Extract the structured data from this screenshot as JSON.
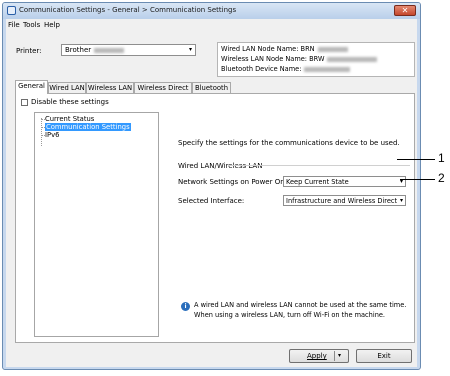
{
  "window": {
    "title": "Communication Settings - General > Communication Settings",
    "close_glyph": "✕"
  },
  "menu": [
    "File",
    "Tools",
    "Help"
  ],
  "printer": {
    "label": "Printer:",
    "value": "Brother",
    "chevron": "▾"
  },
  "info": {
    "wired_lan_node_name": "Wired LAN Node Name: BRN",
    "wireless_lan_node_name": "Wireless LAN Node Name: BRW",
    "bluetooth_device_name": "Bluetooth Device Name:"
  },
  "tabs": [
    "General",
    "Wired LAN",
    "Wireless LAN",
    "Wireless Direct",
    "Bluetooth"
  ],
  "active_tab": "General",
  "disable_settings": {
    "label": "Disable these settings",
    "checked": false
  },
  "tree": [
    "Current Status",
    "Communication Settings",
    "IPv6"
  ],
  "tree_selected": "Communication Settings",
  "description": "Specify the settings for the communications device to be used.",
  "group_label": "Wired LAN/Wireless LAN",
  "fields": [
    {
      "label": "Network Settings on Power On:",
      "value": "Keep Current State"
    },
    {
      "label": "Selected Interface:",
      "value": "Infrastructure and Wireless Direct"
    }
  ],
  "note_icon": "i",
  "note_lines": [
    "A wired LAN and wireless LAN cannot be used at the same time.",
    "When using a wireless LAN, turn off Wi-Fi on the machine."
  ],
  "buttons": {
    "apply": "Apply",
    "exit": "Exit"
  },
  "callouts": [
    "1",
    "2"
  ],
  "icons": {
    "dropdown": "▾"
  },
  "colors": {
    "selection": "#3399ff",
    "window_frame": "#c7d8ee",
    "info_icon": "#2a6ebc"
  }
}
